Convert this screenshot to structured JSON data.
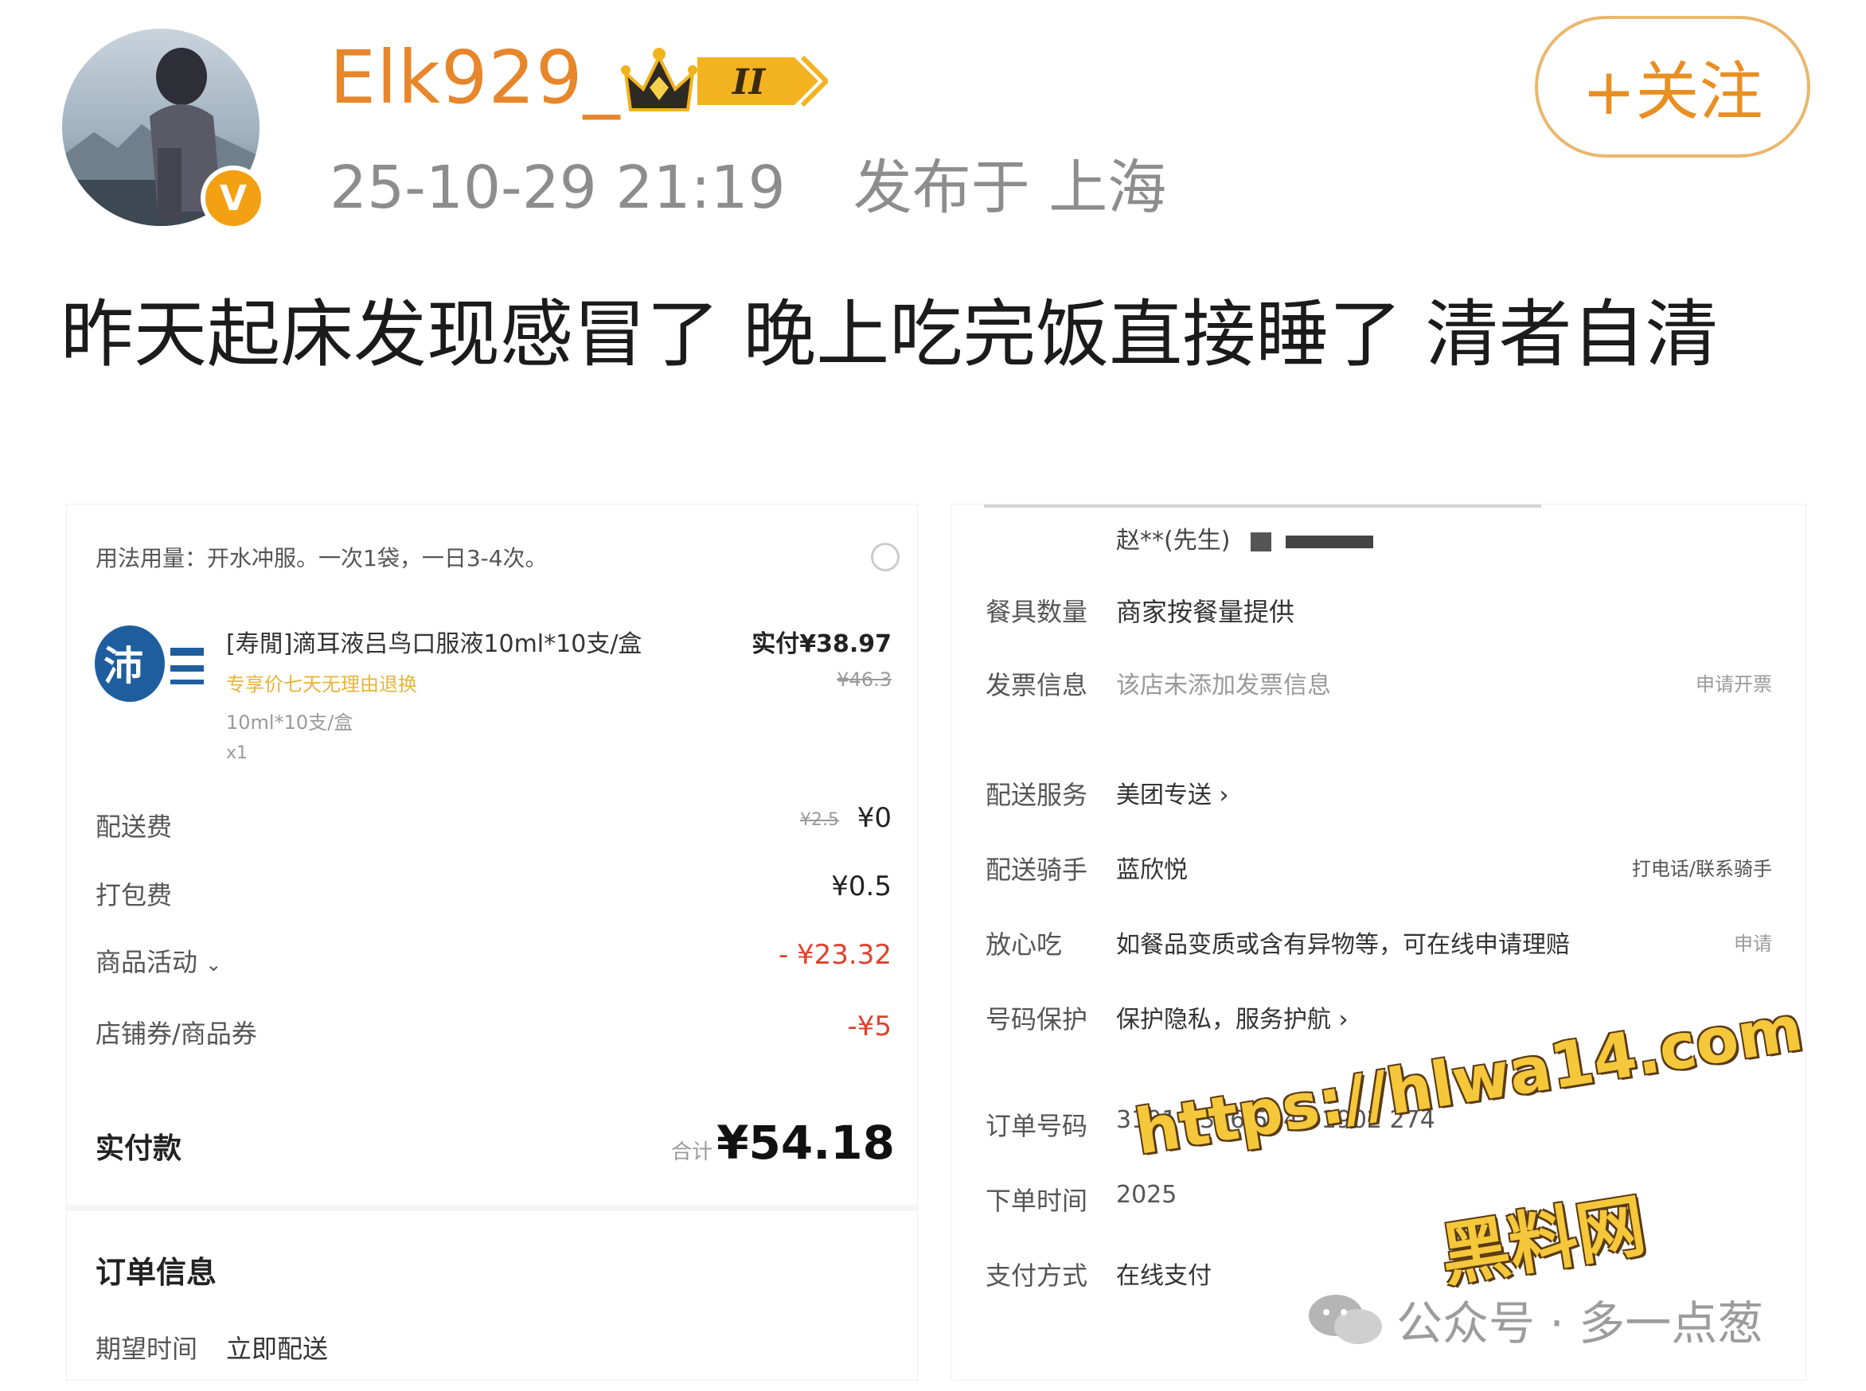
{
  "header": {
    "username": "Elk929_",
    "level_badge": "II",
    "timestamp": "25-10-29 21:19",
    "location": "发布于 上海",
    "follow_label": "+关注",
    "verified_mark": "V"
  },
  "post": {
    "text": "昨天起床发现感冒了 晚上吃完饭直接睡了  清者自清"
  },
  "order_left": {
    "usage_note": "用法用量：开水冲服。一次1袋，一日3-4次。",
    "product": {
      "name": "[寿閒]滴耳液吕鸟口服液10ml*10支/盒",
      "promo": "专享价七天无理由退换",
      "spec": "10ml*10支/盒",
      "qty": "x1",
      "paid": "实付¥38.97",
      "original": "¥46.3"
    },
    "fees": [
      {
        "label": "配送费",
        "strike": "¥2.5",
        "value": "¥0"
      },
      {
        "label": "打包费",
        "strike": "",
        "value": "¥0.5"
      },
      {
        "label": "商品活动",
        "strike": "",
        "value": "- ¥23.32"
      },
      {
        "label": "店铺券/商品券",
        "strike": "",
        "value": "-¥5"
      }
    ],
    "total_label": "实付款",
    "total_prefix": "合计",
    "total_value": "¥54.18",
    "order_info_title": "订单信息",
    "expected_time_label": "期望时间",
    "expected_time_value": "立即配送"
  },
  "order_right": {
    "recipient": "赵**(先生)",
    "rows": [
      {
        "label": "餐具数量",
        "value": "商家按餐量提供",
        "extra": ""
      },
      {
        "label": "发票信息",
        "value": "该店未添加发票信息",
        "extra": "申请开票"
      },
      {
        "label": "配送服务",
        "value": "美团专送 ›",
        "extra": ""
      },
      {
        "label": "配送骑手",
        "value": "蓝欣悦",
        "extra": "打电话/联系骑手"
      },
      {
        "label": "放心吃",
        "value": "如餐品变质或含有异物等，可在线申请理赔",
        "extra": "申请"
      },
      {
        "label": "号码保护",
        "value": "保护隐私，服务护航 ›",
        "extra": ""
      },
      {
        "label": "订单号码",
        "value": "3101 8386 5243 1902 274",
        "extra": ""
      },
      {
        "label": "下单时间",
        "value": "2025",
        "extra": ""
      },
      {
        "label": "支付方式",
        "value": "在线支付",
        "extra": ""
      }
    ]
  },
  "watermark": {
    "url": "https://hlwa14.com",
    "site": "黑料网",
    "account": "公众号 · 多一点葱"
  }
}
